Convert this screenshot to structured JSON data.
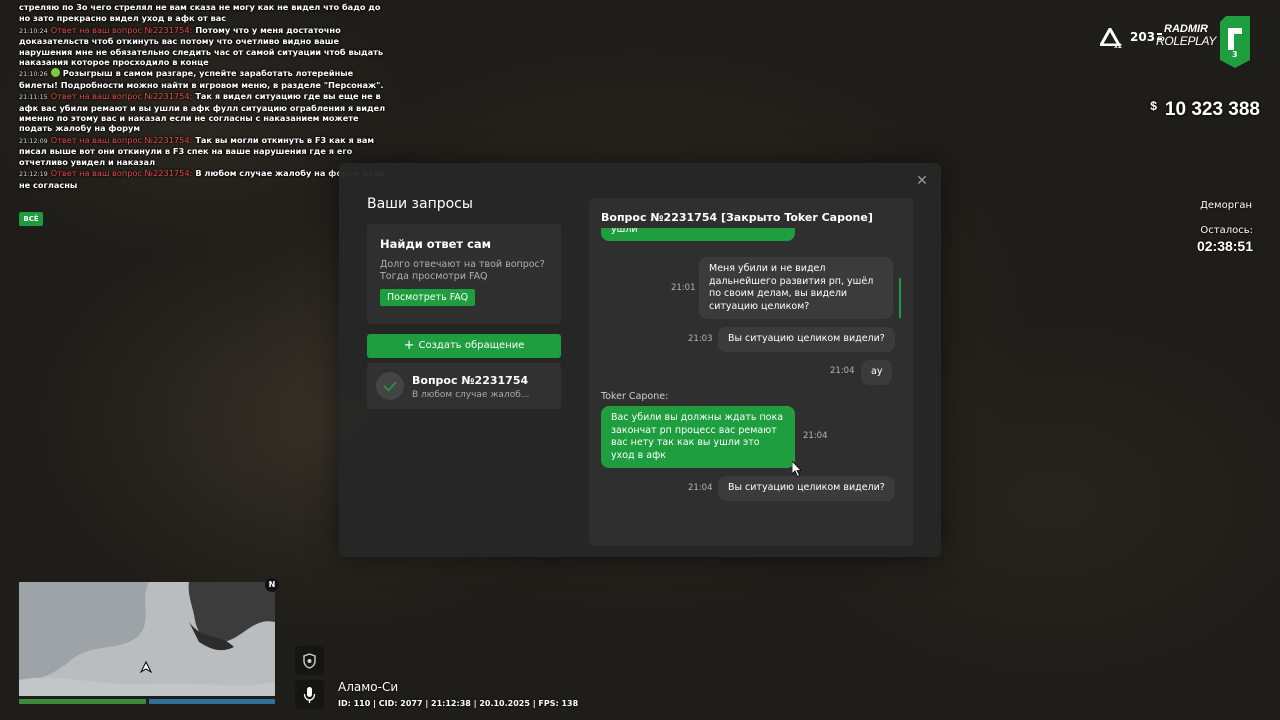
{
  "chat": {
    "messages": [
      {
        "time": "",
        "tag": "",
        "text": "стреляю по 3о чего стрелял не вам сказа не могу как не видел что бадо до",
        "emoji": false
      },
      {
        "time": "",
        "tag": "",
        "text": "но зато прекрасно видел уход в афк от вас",
        "emoji": false
      },
      {
        "time": "21:10:24",
        "tag": "Ответ на ваш вопрос №2231754:",
        "text": "Потому что у меня достаточно доказательств чтоб откинуть вас потому что очетливо видно ваше нарушения мне не обязательно следить час от самой ситуации чтоб выдать наказания которое просходило в конце",
        "emoji": false
      },
      {
        "time": "21:10:26",
        "tag": "",
        "text": "Розыгрыш в самом разгаре, успейте заработать лотерейные билеты! Подробности можно найти в игровом меню, в разделе \"Персонаж\".",
        "emoji": true
      },
      {
        "time": "21:11:15",
        "tag": "Ответ на ваш вопрос №2231754:",
        "text": "Так я видел ситуацию где вы еще не в афк вас убили ремают и вы ушли в афк фулл ситуацию ограбления я видел именно по этому вас и наказал если не согласны с наказанием можете подать жалобу на форум",
        "emoji": false
      },
      {
        "time": "21:12:09",
        "tag": "Ответ на ваш вопрос №2231754:",
        "text": "Так вы могли откинуть в F3 как я вам писал выше вот они откинули в F3 спек на ваше нарушения где я его отчетливо увидел и наказал",
        "emoji": false
      },
      {
        "time": "21:12:19",
        "tag": "Ответ на ваш вопрос №2231754:",
        "text": "В любом случае жалобу на форум если не согласны",
        "emoji": false
      }
    ],
    "filter_label": "ВСЁ"
  },
  "hud": {
    "multiplier": "x2",
    "online": "203",
    "brand_line1": "RADMIR",
    "brand_line2": "ROLEPLAY",
    "server_number": "3",
    "currency_symbol": "$",
    "money": "10 323 388",
    "jail_label": "Деморган",
    "remaining_label": "Осталось:",
    "remaining_time": "02:38:51"
  },
  "modal": {
    "title": "Ваши запросы",
    "close_icon": "close-icon",
    "faq": {
      "title": "Найди ответ сам",
      "text": "Долго отвечают на твой вопрос? Тогда просмотри FAQ",
      "button": "Посмотреть FAQ"
    },
    "create_button": "Создать обращение",
    "ticket": {
      "title": "Вопрос №2231754",
      "preview": "В любом случае жалоб..."
    },
    "conversation": {
      "header": "Вопрос №2231754 [Закрыто Toker Capone]",
      "partial_bubble": "ушли",
      "messages": [
        {
          "side": "user",
          "time": "21:01",
          "text": "Меня убили и не видел дальнейшего развития рп, ушёл по своим делам, вы видели ситуацию целиком?"
        },
        {
          "side": "user",
          "time": "21:03",
          "text": "Вы ситуацию целиком видели?"
        },
        {
          "side": "user",
          "time": "21:04",
          "text": "ау"
        },
        {
          "side": "admin",
          "sender": "Toker Capone:",
          "time": "21:04",
          "text": "Вас убили вы должны ждать пока закончат рп процесс вас ремают вас нету так как вы ушли это уход в афк"
        },
        {
          "side": "user",
          "time": "21:04",
          "text": "Вы ситуацию целиком видели?"
        }
      ]
    }
  },
  "map": {
    "north": "N"
  },
  "location": {
    "name": "Аламо-Си",
    "info": "ID: 110 | CID: 2077 | 21:12:38 | 20.10.2025 | FPS: 138"
  },
  "colors": {
    "accent": "#1e9e3e",
    "chat_tag": "#e24a4a",
    "panel": "#262626"
  }
}
